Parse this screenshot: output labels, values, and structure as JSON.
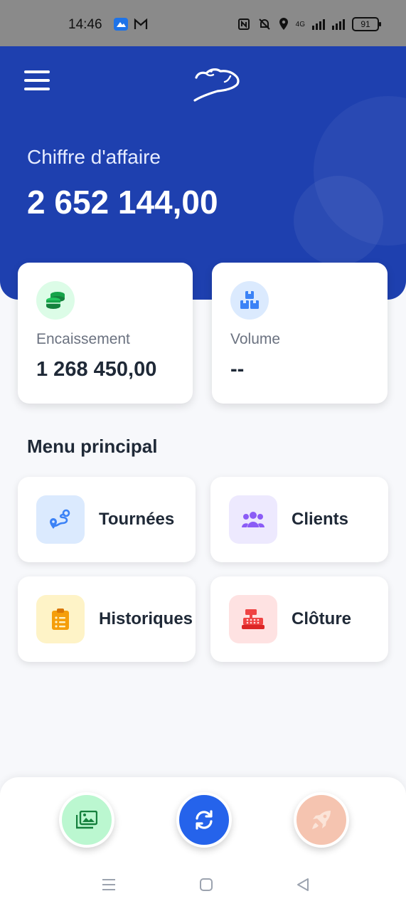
{
  "status_bar": {
    "time": "14:46",
    "battery": "91",
    "network": "4G"
  },
  "header": {
    "brand_logo": "polar-bear-logo",
    "revenue_label": "Chiffre d'affaire",
    "revenue_value": "2 652 144,00"
  },
  "stats": [
    {
      "label": "Encaissement",
      "value": "1 268 450,00",
      "icon": "coins-stack-icon",
      "color": "#16a34a"
    },
    {
      "label": "Volume",
      "value": "--",
      "icon": "boxes-icon",
      "color": "#3b82f6"
    }
  ],
  "menu": {
    "title": "Menu principal",
    "items": [
      {
        "label": "Tournées",
        "icon": "route-icon",
        "color": "#3b82f6"
      },
      {
        "label": "Clients",
        "icon": "users-icon",
        "color": "#8b5cf6"
      },
      {
        "label": "Historiques",
        "icon": "clipboard-list-icon",
        "color": "#f59e0b"
      },
      {
        "label": "Clôture",
        "icon": "cash-register-icon",
        "color": "#ef4444"
      }
    ]
  },
  "actions": {
    "gallery": "images-icon",
    "sync": "sync-icon",
    "launch": "rocket-icon"
  },
  "colors": {
    "primary": "#1e40af",
    "sync_button": "#2563eb"
  }
}
